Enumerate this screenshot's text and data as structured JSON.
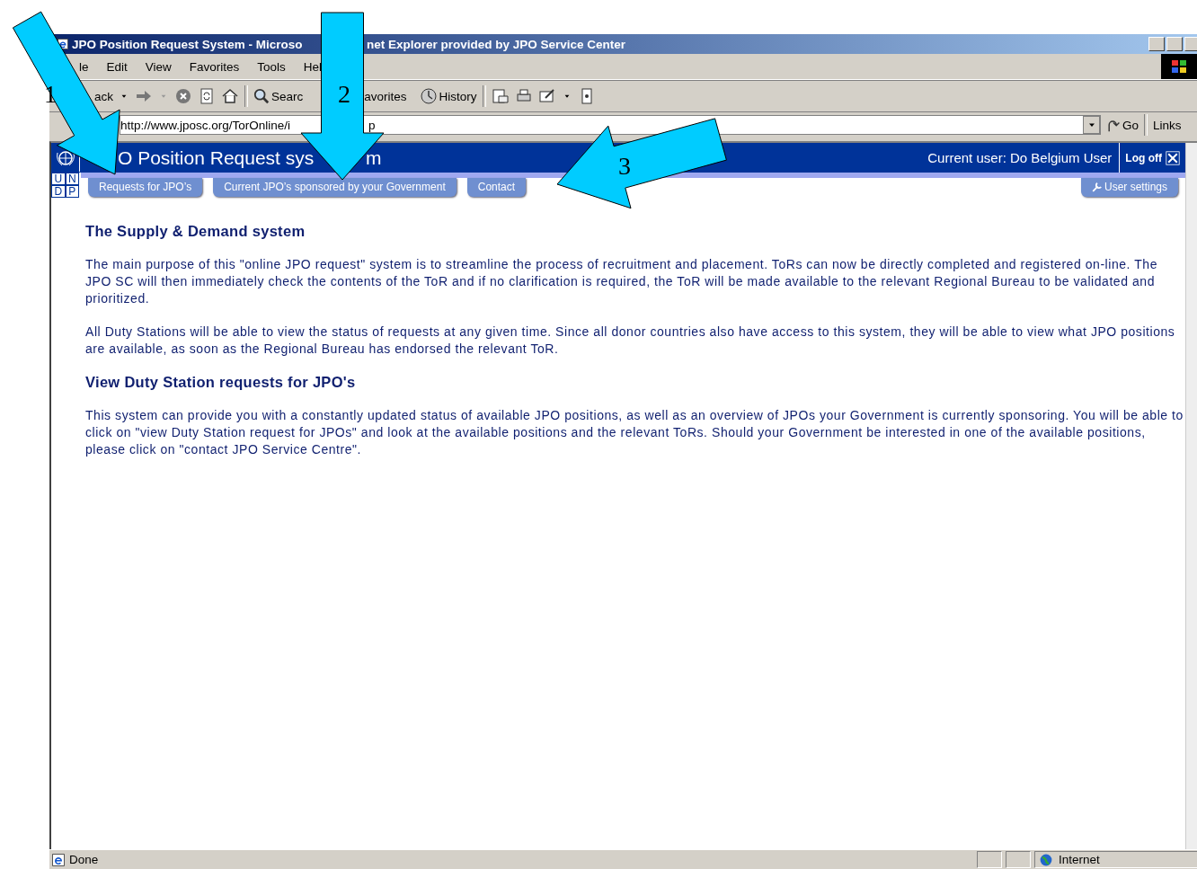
{
  "window": {
    "title_parts": [
      "JPO Position Request System - Microso",
      "net Explorer provided by JPO Service Center"
    ]
  },
  "menu": [
    "le",
    "Edit",
    "View",
    "Favorites",
    "Tools",
    "Hel"
  ],
  "toolbar": {
    "back": "ack",
    "search": "Searc",
    "favorites": "avorites",
    "history": "History"
  },
  "address": {
    "value_parts": [
      "http://www.jposc.org/TorOnline/i",
      "p"
    ],
    "go": "Go",
    "links": "Links"
  },
  "header": {
    "title_parts": [
      "O Position Request sys",
      "m"
    ],
    "logo_letters": [
      "U",
      "N",
      "D",
      "P"
    ],
    "current_user": "Current user: Do Belgium User",
    "logoff": "Log off"
  },
  "nav_tabs": [
    "Requests for JPO’s",
    "Current JPO’s sponsored by your Government",
    "Contact"
  ],
  "user_settings": "User settings",
  "sections": [
    {
      "heading": "The Supply & Demand system",
      "paragraphs": [
        "The main purpose of this \"online JPO request\" system is to streamline the process of recruitment and placement. ToRs can now be directly completed and registered on-line. The JPO SC will then immediately check the contents of the ToR and if no clarification is required, the ToR will be made available to the relevant Regional Bureau to be validated and prioritized.",
        "All Duty Stations will be able to view the status of requests at any given time. Since all donor countries also have access to this system, they will be able to view what JPO positions are available, as soon as the Regional Bureau has endorsed the relevant ToR."
      ]
    },
    {
      "heading": "View Duty Station requests for JPO's",
      "paragraphs": [
        "This system can provide you with a constantly updated status of available JPO positions, as well as an overview of JPOs your Government is currently sponsoring. You will be able to click on \"view Duty Station request for JPOs\" and look at the available positions and the relevant ToRs. Should your Government be interested in one of the available positions, please click on \"contact JPO Service Centre\"."
      ]
    }
  ],
  "status_bar": {
    "text": "Done",
    "zone": "Internet"
  },
  "callouts": [
    {
      "number": "1"
    },
    {
      "number": "2"
    },
    {
      "number": "3"
    }
  ]
}
